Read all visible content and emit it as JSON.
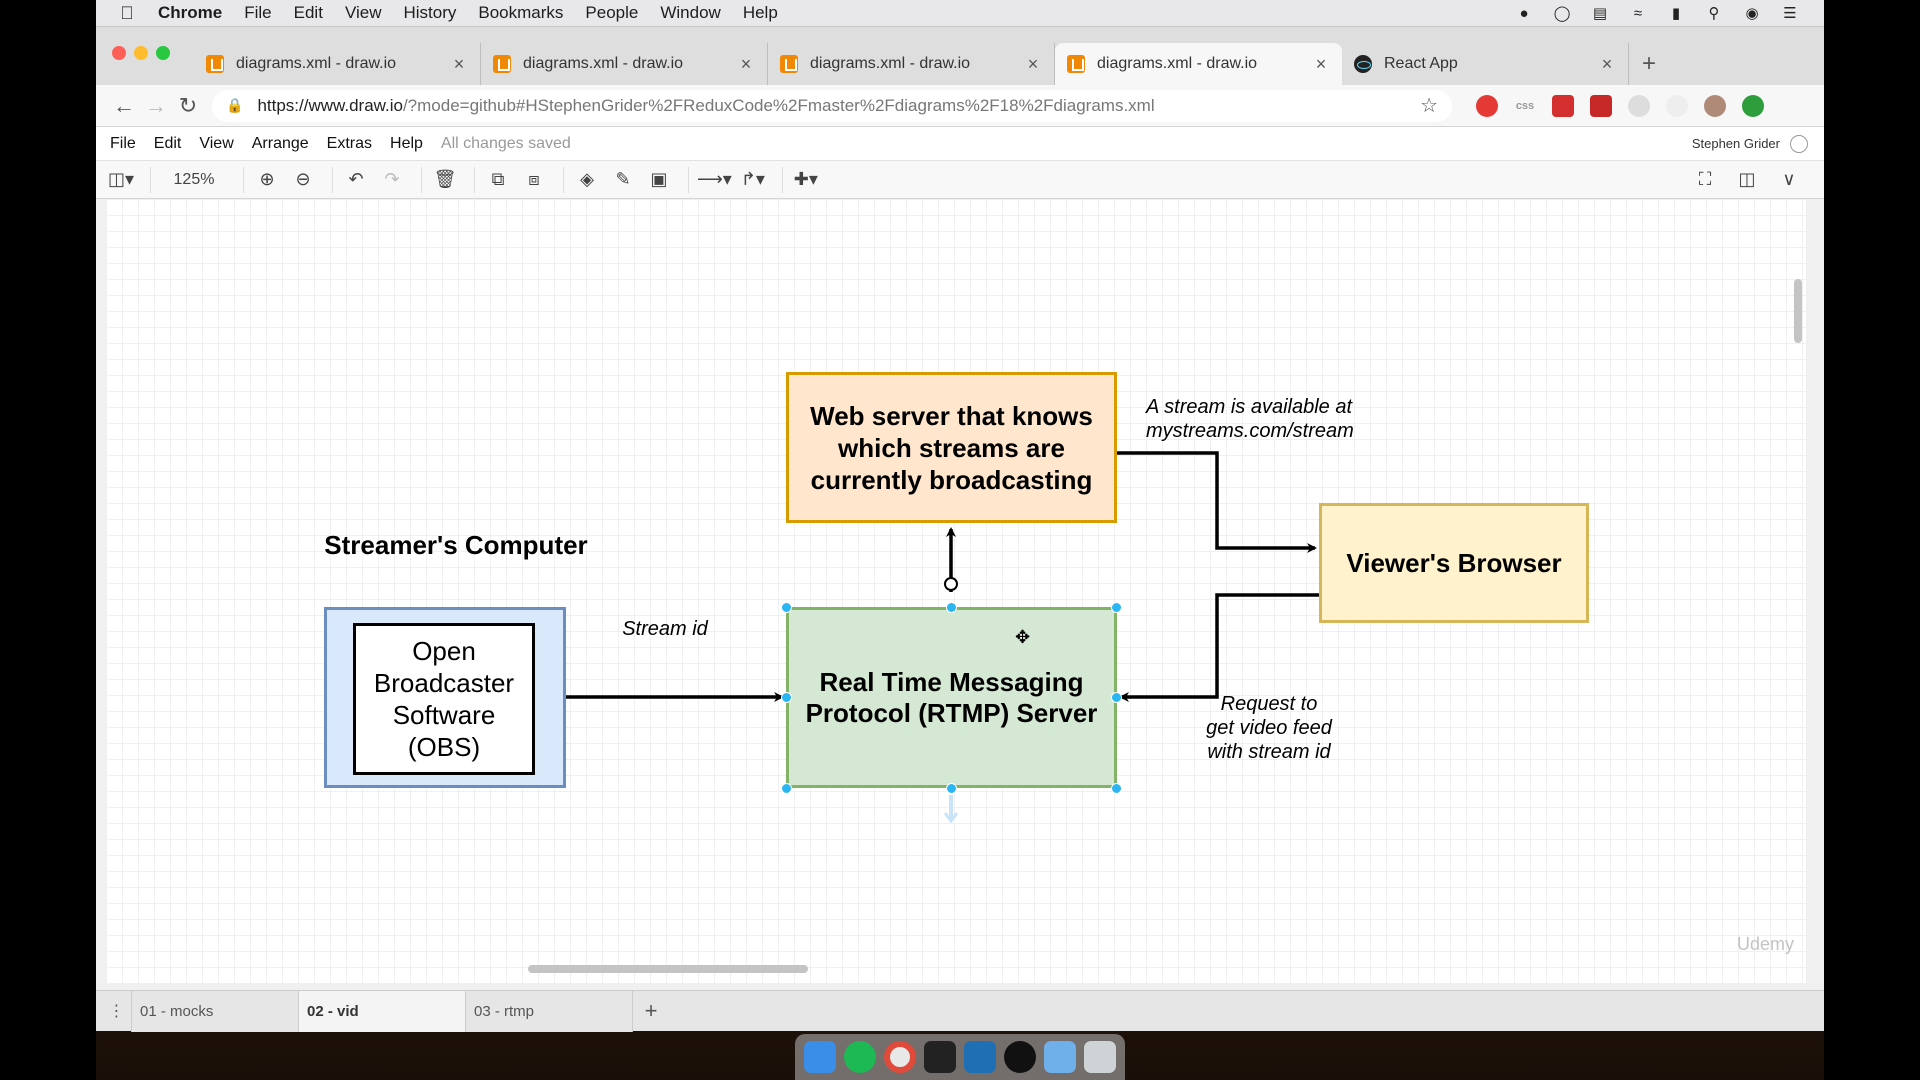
{
  "menubar": {
    "items": [
      "Chrome",
      "File",
      "Edit",
      "View",
      "History",
      "Bookmarks",
      "People",
      "Window",
      "Help"
    ]
  },
  "browser": {
    "tabs": [
      {
        "title": "diagrams.xml - draw.io",
        "active": false
      },
      {
        "title": "diagrams.xml - draw.io",
        "active": false
      },
      {
        "title": "diagrams.xml - draw.io",
        "active": false
      },
      {
        "title": "diagrams.xml - draw.io",
        "active": true
      },
      {
        "title": "React App",
        "active": false
      }
    ],
    "url_host": "https://www.draw.io",
    "url_rest": "/?mode=github#HStephenGrider%2FReduxCode%2Fmaster%2Fdiagrams%2F18%2Fdiagrams.xml",
    "ext_css_label": "css"
  },
  "drawio": {
    "menu": [
      "File",
      "Edit",
      "View",
      "Arrange",
      "Extras",
      "Help"
    ],
    "status": "All changes saved",
    "user": "Stephen Grider",
    "zoom": "125%",
    "pages": [
      {
        "label": "01 - mocks",
        "active": false
      },
      {
        "label": "02 - vid",
        "active": true
      },
      {
        "label": "03 - rtmp",
        "active": false
      }
    ]
  },
  "diagram": {
    "web_server": "Web server that knows which streams are currently broadcasting",
    "viewer": "Viewer's Browser",
    "rtmp": "Real Time Messaging Protocol (RTMP) Server",
    "streamer_title": "Streamer's Computer",
    "obs": "Open Broadcaster Software (OBS)",
    "label_stream_id": "Stream id",
    "label_available": "A stream is available at mystreams.com/stream",
    "label_request": "Request to get video feed with stream id"
  },
  "watermark": "Udemy",
  "colors": {
    "web_server_fill": "#ffe6cc",
    "viewer_fill": "#fff2cc",
    "rtmp_fill": "#d5e8d4",
    "streamer_fill": "#dae8fc",
    "selection_handle": "#29b6f2"
  }
}
